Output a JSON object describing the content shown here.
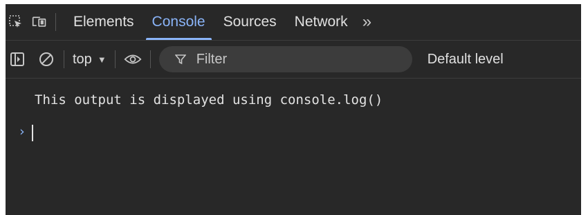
{
  "tabs": {
    "items": [
      {
        "label": "Elements"
      },
      {
        "label": "Console"
      },
      {
        "label": "Sources"
      },
      {
        "label": "Network"
      }
    ],
    "more_label": "»",
    "active": "Console"
  },
  "toolbar": {
    "context_label": "top",
    "filter_placeholder": "Filter",
    "levels_label": "Default level"
  },
  "console": {
    "messages": [
      {
        "text": "This output is displayed using console.log()"
      }
    ],
    "prompt_symbol": "›"
  },
  "colors": {
    "background": "#282828",
    "accent": "#8ab4f8",
    "text": "#e3e3e3"
  }
}
